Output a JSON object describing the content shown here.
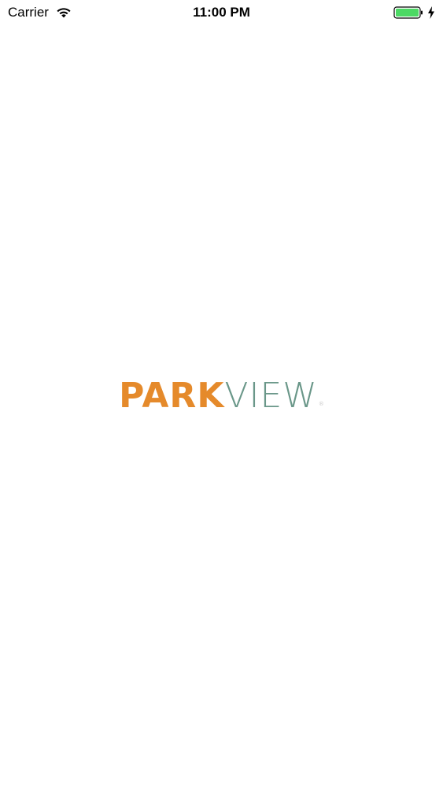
{
  "status_bar": {
    "carrier": "Carrier",
    "time": "11:00 PM",
    "wifi_icon": "wifi-icon",
    "battery_icon": "battery-icon",
    "charging_icon": "charging-bolt-icon",
    "battery_color": "#4cd964"
  },
  "logo": {
    "park": "PARK",
    "view": "VIEW",
    "mark": "®",
    "park_color": "#e58a2b",
    "view_color": "#6a9789"
  }
}
